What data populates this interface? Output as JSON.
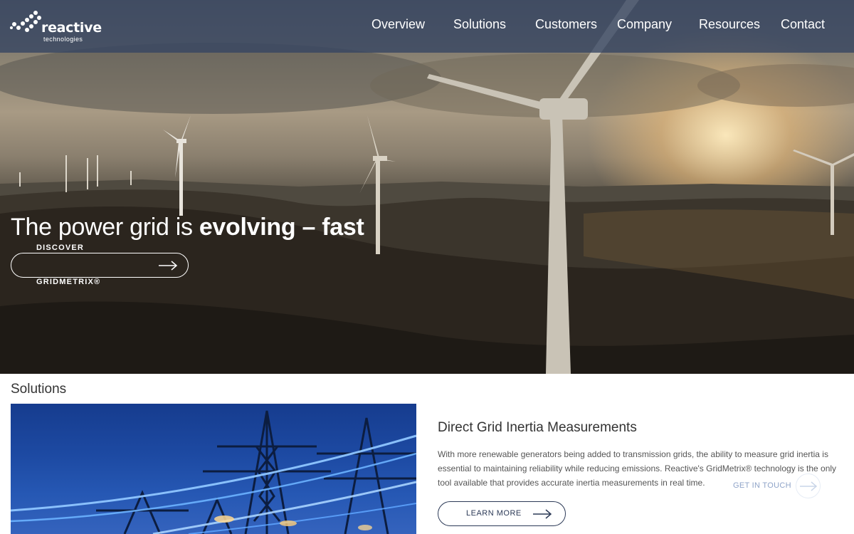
{
  "header": {
    "logo": {
      "word": "reactive",
      "sub": "technologies"
    },
    "nav": [
      {
        "label": "Overview"
      },
      {
        "label": "Solutions"
      },
      {
        "label": "Customers"
      },
      {
        "label": "Company"
      },
      {
        "label": "Resources"
      },
      {
        "label": "Contact"
      }
    ]
  },
  "hero": {
    "headline_regular": "The power grid is ",
    "headline_bold": "evolving – fast",
    "cta_top": "DISCOVER",
    "cta_bottom": "GRIDMETRIX®",
    "cta_icon": "arrow-right-icon"
  },
  "solutions": {
    "title": "Solutions",
    "card": {
      "title": "Direct Grid Inertia Measurements",
      "body": "With more renewable generators being added to transmission grids, the ability to measure grid inertia is essential to maintaining reliability while reducing emissions. Reactive's GridMetrix® technology is the only tool available that provides accurate inertia measurements in real time.",
      "button": "LEARN MORE"
    },
    "get_in_touch": "GET IN TOUCH"
  },
  "colors": {
    "nav_bg": "#344462",
    "accent": "#2c3a57",
    "muted_link": "#8fa4c8"
  }
}
